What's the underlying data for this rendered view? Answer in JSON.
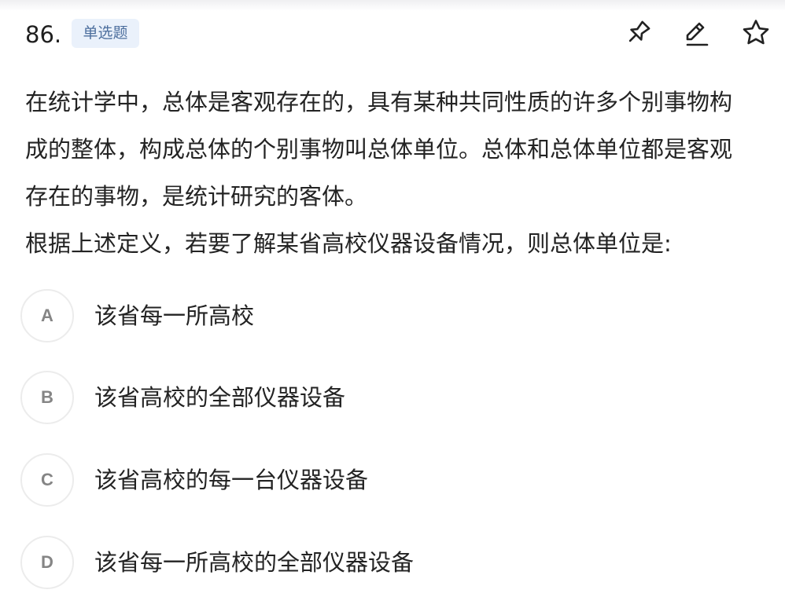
{
  "question": {
    "number": "86.",
    "type_badge": "单选题",
    "stem_lines": [
      "在统计学中，总体是客观存在的，具有某种共同性质的许多个别事物构",
      "成的整体，构成总体的个别事物叫总体单位。总体和总体单位都是客观",
      "存在的事物，是统计研究的客体。"
    ],
    "ask": "根据上述定义，若要了解某省高校仪器设备情况，则总体单位是:"
  },
  "toolbar": {
    "pin_icon": "pin-icon",
    "edit_icon": "edit-icon",
    "star_icon": "star-icon",
    "icon_color": "#222222"
  },
  "options": [
    {
      "letter": "A",
      "text": "该省每一所高校"
    },
    {
      "letter": "B",
      "text": "该省高校的全部仪器设备"
    },
    {
      "letter": "C",
      "text": "该省高校的每一台仪器设备"
    },
    {
      "letter": "D",
      "text": "该省每一所高校的全部仪器设备"
    }
  ],
  "colors": {
    "badge_bg": "#eaf1fb",
    "badge_text": "#4d6f9e",
    "option_circle_border": "#ececec",
    "option_letter": "#858585"
  }
}
